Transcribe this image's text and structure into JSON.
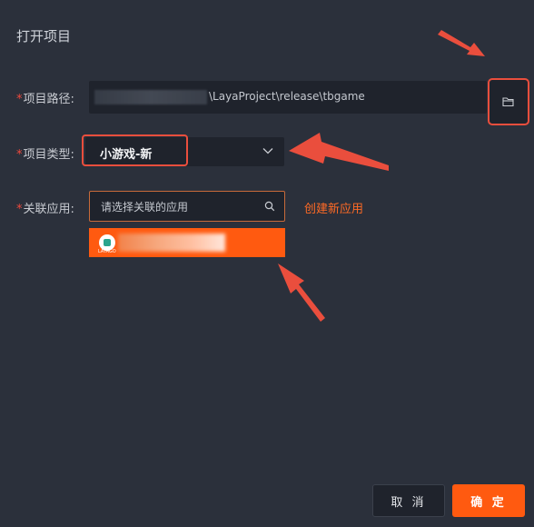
{
  "dialog": {
    "title": "打开项目"
  },
  "fields": {
    "path": {
      "required_mark": "*",
      "label": "项目路径:",
      "value_visible": "\\LayaProject\\release\\tbgame"
    },
    "type": {
      "required_mark": "*",
      "label": "项目类型:",
      "selected": "小游戏-新"
    },
    "app": {
      "required_mark": "*",
      "label": "关联应用:",
      "placeholder": "请选择关联的应用",
      "create_link": "创建新应用",
      "logo_text": "LAYAGO"
    }
  },
  "buttons": {
    "cancel": "取 消",
    "confirm": "确 定"
  },
  "icons": {
    "folder": "folder-open-icon",
    "chevron": "chevron-down-icon",
    "search": "search-icon"
  },
  "colors": {
    "background": "#2b303b",
    "field_bg": "#1f232c",
    "accent": "#ff5a10",
    "annotation": "#ea4e3d"
  }
}
